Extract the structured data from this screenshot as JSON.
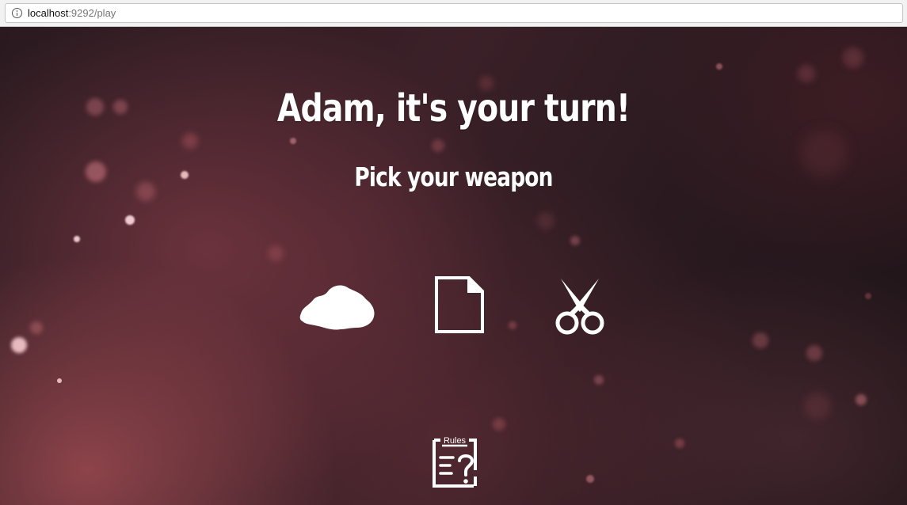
{
  "browser": {
    "url_host": "localhost",
    "url_rest": ":9292/play",
    "info_icon": "info-icon"
  },
  "game": {
    "title": "Adam, it's your turn!",
    "subtitle": "Pick your weapon",
    "weapons": [
      {
        "name": "rock",
        "icon": "rock-icon"
      },
      {
        "name": "paper",
        "icon": "paper-icon"
      },
      {
        "name": "scissors",
        "icon": "scissors-icon"
      }
    ],
    "rules": {
      "label": "Rules",
      "icon": "rules-icon"
    }
  },
  "colors": {
    "text": "#ffffff",
    "icon": "#ffffff",
    "background_dark": "#1c1216",
    "background_glow": "#aa5056"
  }
}
